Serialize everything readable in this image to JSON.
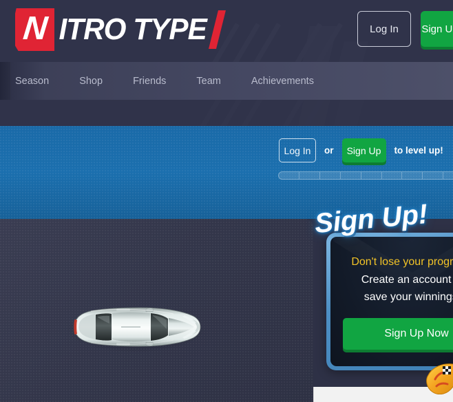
{
  "site": {
    "logo_letter": "N",
    "logo_word": "ITRO TYPE",
    "accent_red": "#e02434",
    "accent_green": "#11a542",
    "header_bg": "#30334a",
    "banner_blue": "#1b6fae"
  },
  "header": {
    "login_label": "Log In",
    "signup_label": "Sign Up"
  },
  "nav": {
    "items": [
      {
        "label": "Season"
      },
      {
        "label": "Shop"
      },
      {
        "label": "Friends"
      },
      {
        "label": "Team"
      },
      {
        "label": "Achievements"
      }
    ]
  },
  "banner": {
    "login_label": "Log In",
    "or_label": "or",
    "signup_label": "Sign Up",
    "tail_label": "to level up!",
    "xp_segments": 10,
    "xp_filled": 0
  },
  "car_panel": {
    "car_name": "silver-sedan-top-view"
  },
  "signup_panel": {
    "title": "Sign Up!",
    "line1": "Don't lose your progress!",
    "line2": "Create an account to",
    "line3": "save your winnings.",
    "cta_label": "Sign Up Now",
    "highlight_color": "#f2c327"
  },
  "badge": {
    "icon": "yellow-race-car-checkered-flag"
  }
}
